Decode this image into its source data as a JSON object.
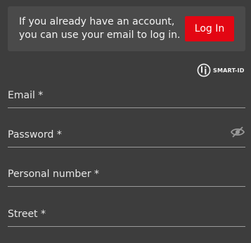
{
  "notice": {
    "line1": "If you already have an account,",
    "line2": "you can use your email to log in.",
    "login_label": "Log In"
  },
  "smart_id": {
    "label": "SMART-ID",
    "icon": "smart-id-logo-icon"
  },
  "fields": [
    {
      "label": "Email *",
      "value": ""
    },
    {
      "label": "Password *",
      "value": "",
      "icon": "eye-slash-icon"
    },
    {
      "label": "Personal number *",
      "value": ""
    },
    {
      "label": "Street *",
      "value": ""
    }
  ],
  "colors": {
    "background": "#3d3d3d",
    "notice_background": "#4a4a4a",
    "accent": "#e30613",
    "text": "#f2f2f2",
    "underline": "#9a9a9a"
  }
}
